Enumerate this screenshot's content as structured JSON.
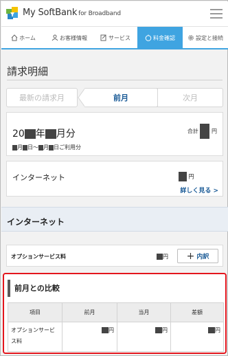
{
  "header": {
    "app_title": "My SoftBank",
    "app_subtitle": "for Broadband"
  },
  "nav": {
    "tabs": [
      {
        "label": "ホーム",
        "icon": "home-icon"
      },
      {
        "label": "お客様情報",
        "icon": "user-icon"
      },
      {
        "label": "サービス",
        "icon": "service-icon"
      },
      {
        "label": "料金確認",
        "icon": "yen-icon",
        "active": true
      },
      {
        "label": "設定と接続",
        "icon": "gear-icon"
      }
    ]
  },
  "page": {
    "title": "請求明細"
  },
  "months": {
    "latest": "最新の請求月",
    "previous": "前月",
    "next": "次月"
  },
  "bill": {
    "prefix": "20",
    "year_suffix": "年",
    "month_suffix": "月分",
    "period_month1": "月",
    "period_day1": "日～",
    "period_month2": "月",
    "period_day2": "日ご利用分",
    "total_label": "合計",
    "total_unit": "円"
  },
  "internet_row": {
    "label": "インターネット",
    "unit": "円",
    "detail_link": "詳しく見る >"
  },
  "section": {
    "title": "インターネット"
  },
  "option": {
    "label": "オプションサービス料",
    "unit": "円",
    "button_label": "内訳"
  },
  "comparison": {
    "title": "前月との比較",
    "headers": [
      "項目",
      "前月",
      "当月",
      "差額"
    ],
    "rows": [
      {
        "item": "オプションサービス料",
        "prev_unit": "円",
        "curr_unit": "円",
        "diff_unit": "円"
      }
    ]
  },
  "colors": {
    "accent": "#3fa4e1",
    "link": "#1b5b97",
    "highlight_border": "#e3151c"
  }
}
